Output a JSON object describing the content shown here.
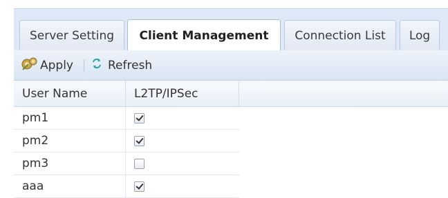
{
  "tabs": [
    {
      "label": "Server Setting",
      "active": false
    },
    {
      "label": "Client Management",
      "active": true
    },
    {
      "label": "Connection List",
      "active": false
    },
    {
      "label": "Log",
      "active": false
    }
  ],
  "toolbar": {
    "apply_label": "Apply",
    "apply_icon": "apply-icon",
    "refresh_label": "Refresh",
    "refresh_icon": "refresh-icon"
  },
  "grid": {
    "columns": [
      "User Name",
      "L2TP/IPSec"
    ],
    "rows": [
      {
        "user": "pm1",
        "l2tp": true
      },
      {
        "user": "pm2",
        "l2tp": true
      },
      {
        "user": "pm3",
        "l2tp": false
      },
      {
        "user": "aaa",
        "l2tp": true
      }
    ]
  },
  "colors": {
    "tab_strip": "#dfe8f6",
    "toolbar": "#d9e4f2",
    "refresh_icon": "#2aa6a0"
  }
}
